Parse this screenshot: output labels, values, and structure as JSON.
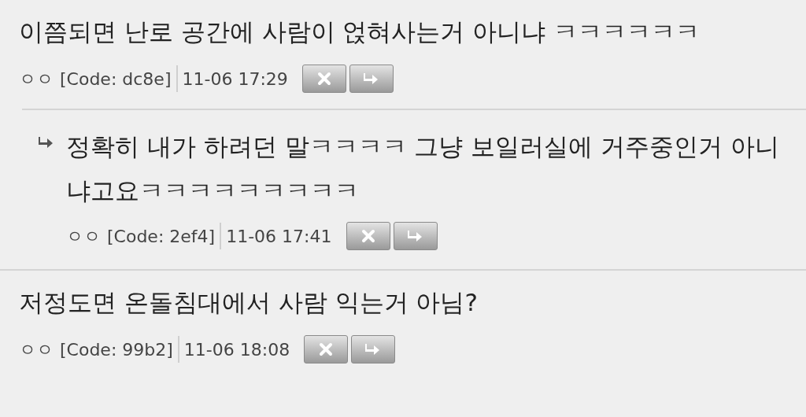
{
  "comments": [
    {
      "text": "이쯤되면 난로 공간에 사람이 얹혀사는거 아니냐 ㅋㅋㅋㅋㅋㅋ",
      "author": "ㅇㅇ",
      "code": "[Code: dc8e]",
      "time": "11-06 17:29",
      "children": [
        {
          "text": "정확히 내가 하려던 말ㅋㅋㅋㅋ 그냥 보일러실에 거주중인거 아니냐고요ㅋㅋㅋㅋㅋㅋㅋㅋㅋ",
          "author": "ㅇㅇ",
          "code": "[Code: 2ef4]",
          "time": "11-06 17:41"
        }
      ]
    },
    {
      "text": "저정도면 온돌침대에서 사람 익는거 아님?",
      "author": "ㅇㅇ",
      "code": "[Code: 99b2]",
      "time": "11-06 18:08"
    }
  ]
}
